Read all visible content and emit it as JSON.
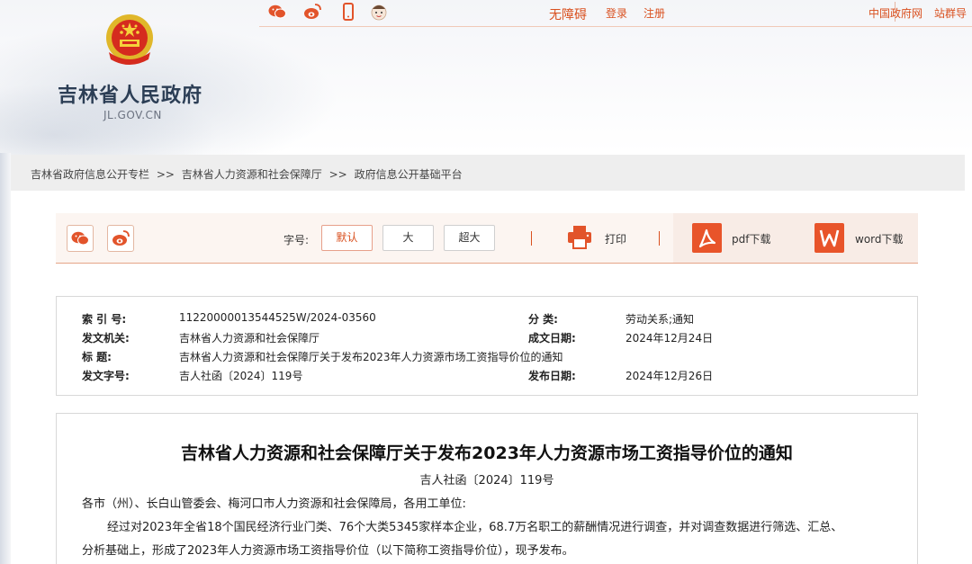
{
  "header": {
    "site_title": "吉林省人民政府",
    "site_domain": "JL.GOV.CN",
    "accessibility": "无障碍",
    "login": "登录",
    "register": "注册",
    "gov_portal": "中国政府网",
    "site_group": "站群导"
  },
  "breadcrumb": {
    "items": [
      "吉林省政府信息公开专栏",
      "吉林省人力资源和社会保障厅",
      "政府信息公开基础平台"
    ],
    "separator": ">>"
  },
  "toolbar": {
    "font_size_label": "字号:",
    "font_default": "默认",
    "font_large": "大",
    "font_xlarge": "超大",
    "print": "打印",
    "pdf_download": "pdf下载",
    "word_download": "word下载"
  },
  "meta": {
    "index_key": "索  引  号:",
    "index_val": "11220000013544525W/2024-03560",
    "category_key": "分      类:",
    "category_val": "劳动关系;通知",
    "issuer_key": "发文机关:",
    "issuer_val": "吉林省人力资源和社会保障厅",
    "created_key": "成文日期:",
    "created_val": "2024年12月24日",
    "title_key": "标      题:",
    "title_val": "吉林省人力资源和社会保障厅关于发布2023年人力资源市场工资指导价位的通知",
    "docno_key": "发文字号:",
    "docno_val": "吉人社函〔2024〕119号",
    "published_key": "发布日期:",
    "published_val": "2024年12月26日"
  },
  "article": {
    "title": "吉林省人力资源和社会保障厅关于发布2023年人力资源市场工资指导价位的通知",
    "doc_number": "吉人社函〔2024〕119号",
    "salutation": "各市（州）、长白山管委会、梅河口市人力资源和社会保障局，各用工单位:",
    "para1_line1": "经过对2023年全省18个国民经济行业门类、76个大类5345家样本企业，68.7万名职工的薪酬情况进行调查，并对调查数据进行筛选、汇总、",
    "para1_line2": "分析基础上，形成了2023年人力资源市场工资指导价位（以下简称工资指导价位），现予发布。"
  },
  "colors": {
    "accent": "#d9501f",
    "download_icon": "#e8542a",
    "toolbar_bg": "#fcf5f1"
  }
}
